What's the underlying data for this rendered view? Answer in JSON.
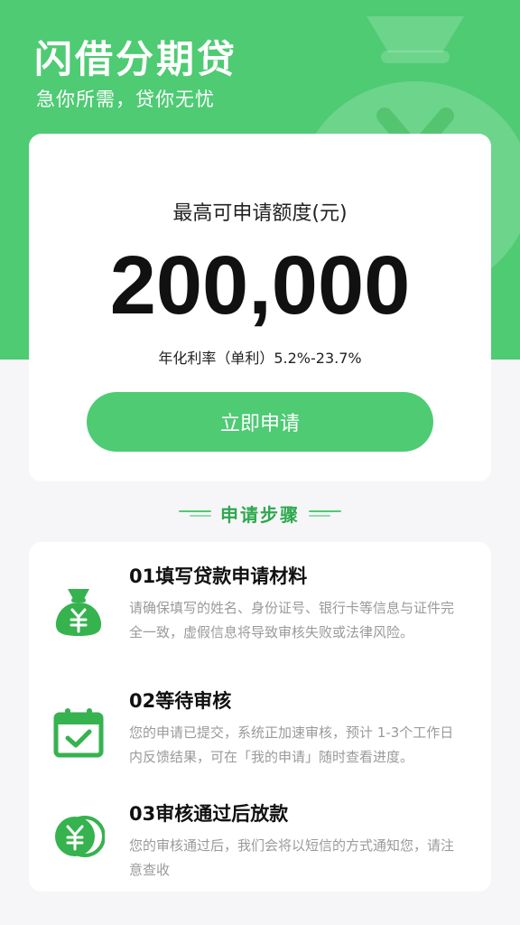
{
  "header": {
    "app_title": "闪借分期贷",
    "slogan": "急你所需，贷你无忧"
  },
  "quota": {
    "label": "最高可申请额度(元)",
    "amount": "200,000",
    "rate_text": "年化利率（单利）5.2%-23.7%",
    "apply_button_label": "立即申请"
  },
  "steps": {
    "title": "申请步骤",
    "items": [
      {
        "title": "01填写贷款申请材料",
        "desc": "请确保填写的姓名、身份证号、银行卡等信息与证件完全一致，虚假信息将导致审核失败或法律风险。",
        "icon": "money-bag-icon"
      },
      {
        "title": "02等待审核",
        "desc": " 您的申请已提交，系统正加速审核，预计 1-3个工作日内反馈结果，可在「我的申请」随时查看进度。",
        "icon": "calendar-check-icon"
      },
      {
        "title": "03审核通过后放款",
        "desc": "您的审核通过后，我们会将以短信的方式通知您，请注意查收",
        "icon": "coins-icon"
      }
    ]
  },
  "colors": {
    "primary": "#4ecb73",
    "icon_green": "#36b24f",
    "steps_title": "#2fa84e",
    "page_bg": "#f6f6f8"
  }
}
